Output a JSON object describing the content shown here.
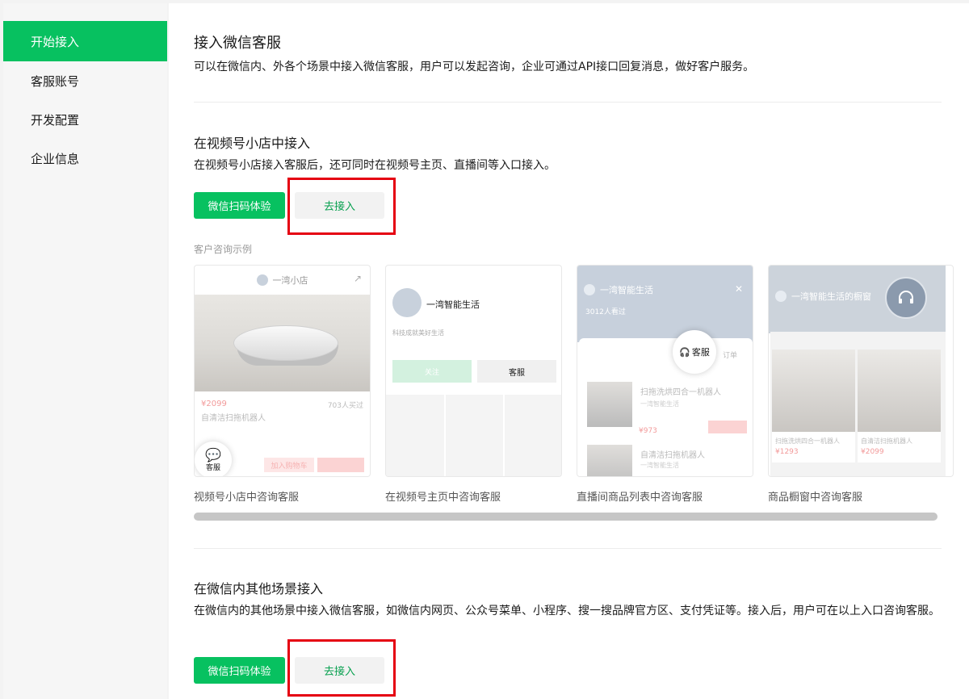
{
  "sidebar": {
    "items": [
      {
        "label": "开始接入",
        "active": true
      },
      {
        "label": "客服账号",
        "active": false
      },
      {
        "label": "开发配置",
        "active": false
      },
      {
        "label": "企业信息",
        "active": false
      }
    ]
  },
  "header": {
    "title": "接入微信客服",
    "description": "可以在微信内、外各个场景中接入微信客服，用户可以发起咨询，企业可通过API接口回复消息，做好客户服务。"
  },
  "section_channels": {
    "title": "在视频号小店中接入",
    "description": "在视频号小店接入客服后，还可同时在视频号主页、直播间等入口接入。",
    "scan_button": "微信扫码体验",
    "connect_button": "去接入",
    "examples_label": "客户咨询示例",
    "examples": [
      {
        "caption": "视频号小店中咨询客服",
        "store_name": "一湾小店",
        "price": "¥2099",
        "sold": "703人买过",
        "product": "自清洁扫拖机器人",
        "cs_label": "客服",
        "cart_label": "加入购物车"
      },
      {
        "caption": "在视频号主页中咨询客服",
        "account_name": "一湾智能生活",
        "tagline": "科技成就美好生活",
        "follow_label": "关注",
        "cs_label": "客服"
      },
      {
        "caption": "直播间商品列表中咨询客服",
        "account_name": "一湾智能生活",
        "viewers": "3012人看过",
        "cs_label": "客服",
        "order_label": "订单",
        "item1": "扫拖洗烘四合一机器人",
        "item1_sub": "一湾智能生活",
        "item1_price": "¥973",
        "item2": "自清洁扫拖机器人",
        "item2_sub": "一湾智能生活"
      },
      {
        "caption": "商品橱窗中咨询客服",
        "title": "一湾智能生活的橱窗",
        "p1": "扫拖洗烘四合一机器人",
        "p1_price": "¥1293",
        "p2": "自清洁扫拖机器人",
        "p2_price": "¥2099"
      }
    ]
  },
  "section_other": {
    "title": "在微信内其他场景接入",
    "description": "在微信内的其他场景中接入微信客服，如微信内网页、公众号菜单、小程序、搜一搜品牌官方区、支付凭证等。接入后，用户可在以上入口咨询客服。",
    "scan_button": "微信扫码体验",
    "connect_button": "去接入"
  },
  "colors": {
    "brand": "#07c160",
    "highlight": "#e50012",
    "link_text": "#07a04f"
  }
}
